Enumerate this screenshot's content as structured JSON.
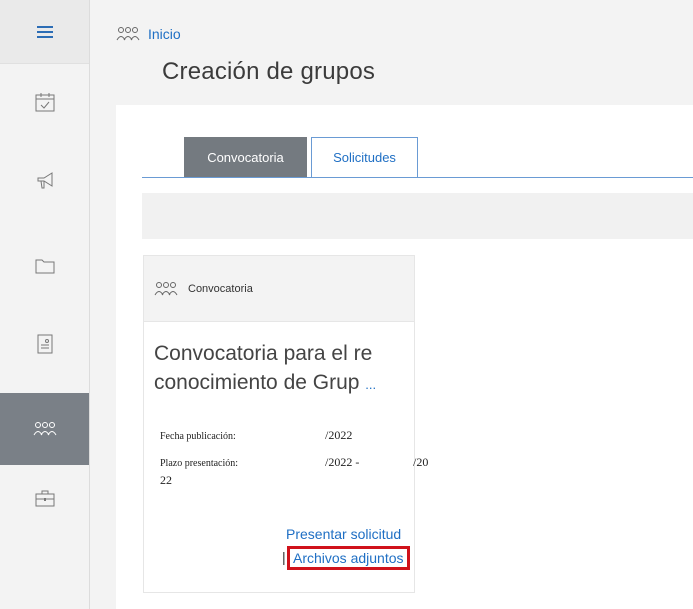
{
  "sidebar": {
    "items": [
      {
        "icon": "menu-icon"
      },
      {
        "icon": "calendar-icon"
      },
      {
        "icon": "megaphone-icon"
      },
      {
        "icon": "folder-icon"
      },
      {
        "icon": "document-icon"
      },
      {
        "icon": "groups-icon"
      },
      {
        "icon": "briefcase-icon"
      }
    ],
    "active_color": "#7a8087"
  },
  "header": {
    "breadcrumb": "Inicio",
    "title": "Creación de grupos"
  },
  "tabs": [
    {
      "label": "Convocatoria",
      "active": true
    },
    {
      "label": "Solicitudes",
      "active": false
    }
  ],
  "card": {
    "header_label": "Convocatoria",
    "title": "Convocatoria para el re conocimiento de Grup",
    "title_ellipsis": "...",
    "fecha_label": "Fecha publicación:",
    "fecha_value": "/2022",
    "plazo_label": "Plazo presentación:",
    "plazo_value": "/2022 -",
    "plazo_value2": "/20",
    "plazo_wrap": "22",
    "link_presentar": "Presentar solicitud",
    "link_separator": "|",
    "link_archivos": "Archivos adjuntos"
  },
  "colors": {
    "accent": "#1f6fc4",
    "highlight": "#d0121b",
    "tab_active": "#747a80"
  }
}
